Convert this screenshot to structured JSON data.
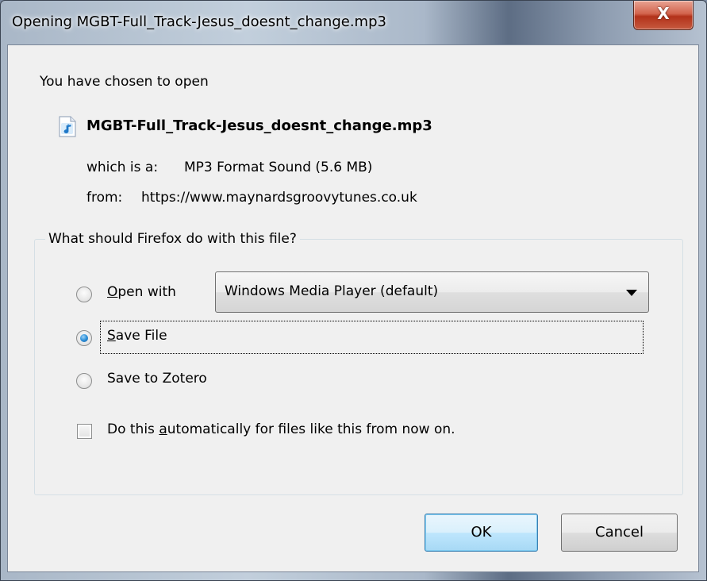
{
  "window": {
    "title": "Opening MGBT-Full_Track-Jesus_doesnt_change.mp3",
    "close_label": "X"
  },
  "header": {
    "intro": "You have chosen to open",
    "file_name": "MGBT-Full_Track-Jesus_doesnt_change.mp3",
    "file_icon": "audio-file-icon",
    "type_label": "which is a:",
    "type_value": "MP3 Format Sound (5.6 MB)",
    "from_label": "from:",
    "from_value": "https://www.maynardsgroovytunes.co.uk"
  },
  "action_group": {
    "legend": "What should Firefox do with this file?",
    "options": [
      {
        "label_accel": "O",
        "label_rest": "pen with",
        "checked": false
      },
      {
        "label_accel": "S",
        "label_rest": "ave File",
        "checked": true
      },
      {
        "label_accel": "",
        "label_rest": "Save to Zotero",
        "checked": false
      }
    ],
    "open_with_value": "Windows Media Player (default)",
    "auto_pre": "Do this ",
    "auto_accel": "a",
    "auto_post": "utomatically for files like this from now on.",
    "auto_checked": false
  },
  "buttons": {
    "ok": "OK",
    "cancel": "Cancel"
  },
  "colors": {
    "client_bg": "#f0f0f0",
    "close_red": "#c65a3f",
    "radio_selected": "#2c8fd8"
  }
}
